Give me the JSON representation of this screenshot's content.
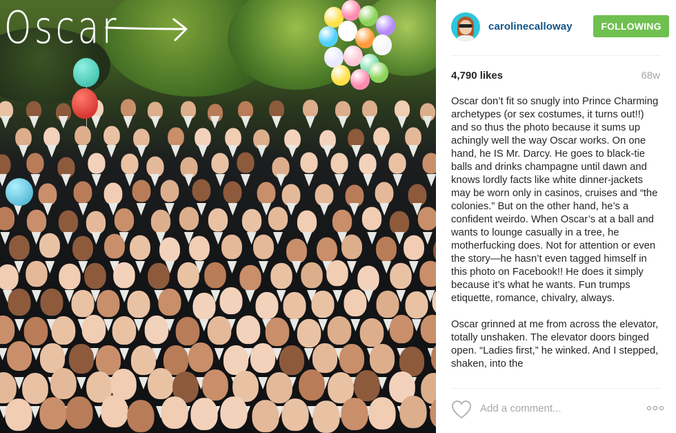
{
  "photo": {
    "handwritten_label": "Oscar"
  },
  "post": {
    "username": "carolinecalloway",
    "follow_label": "FOLLOWING",
    "likes": "4,790 likes",
    "age": "68w",
    "caption_paragraphs": [
      "Oscar don’t fit so snugly into Prince Charming archetypes (or sex costumes, it turns out!!) and so thus the photo because it sums up achingly well the way Oscar works. On one hand, he IS Mr. Darcy. He goes to black-tie balls and drinks champagne until dawn and knows lordly facts like white dinner-jackets may be worn only in casinos, cruises and “the colonies.” But on the other hand, he’s a confident weirdo. When Oscar’s at a ball and wants to lounge casually in a tree, he motherfucking does. Not for attention or even the story—he hasn’t even tagged himself in this photo on Facebook!! He does it simply because it’s what he wants. Fun trumps etiquette, romance, chivalry, always.",
      "Oscar grinned at me from across the elevator, totally unshaken. The elevator doors binged open. “Ladies first,” he winked. And I stepped, shaken, into the"
    ],
    "comment_placeholder": "Add a comment..."
  },
  "colors": {
    "follow_green": "#70c050",
    "username_blue": "#125688",
    "muted_gray": "#a5a7aa"
  },
  "icons": [
    "heart-icon",
    "more-options-icon"
  ]
}
